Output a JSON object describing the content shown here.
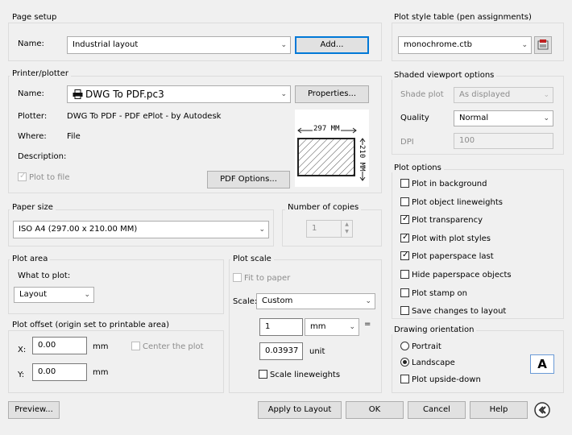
{
  "page_setup": {
    "title": "Page setup",
    "name_label": "Name:",
    "name_value": "Industrial layout",
    "add_button": "Add..."
  },
  "plot_style": {
    "title": "Plot style table (pen assignments)",
    "value": "monochrome.ctb"
  },
  "printer": {
    "title": "Printer/plotter",
    "name_label": "Name:",
    "name_value": "DWG To PDF.pc3",
    "properties_button": "Properties...",
    "plotter_label": "Plotter:",
    "plotter_value": "DWG To PDF - PDF ePlot - by Autodesk",
    "where_label": "Where:",
    "where_value": "File",
    "description_label": "Description:",
    "plot_to_file": "Plot to file",
    "pdf_options_button": "PDF Options...",
    "preview_width": "297 MM",
    "preview_height": "210 MM"
  },
  "shaded": {
    "title": "Shaded viewport options",
    "shade_label": "Shade plot",
    "shade_value": "As displayed",
    "quality_label": "Quality",
    "quality_value": "Normal",
    "dpi_label": "DPI",
    "dpi_value": "100"
  },
  "paper": {
    "title": "Paper size",
    "value": "ISO A4 (297.00 x 210.00 MM)"
  },
  "copies": {
    "title": "Number of copies",
    "value": "1"
  },
  "plot_options": {
    "title": "Plot options",
    "items": [
      {
        "label": "Plot in background",
        "checked": false
      },
      {
        "label": "Plot object lineweights",
        "checked": false
      },
      {
        "label": "Plot transparency",
        "checked": true
      },
      {
        "label": "Plot with plot styles",
        "checked": true
      },
      {
        "label": "Plot paperspace last",
        "checked": true
      },
      {
        "label": "Hide paperspace objects",
        "checked": false
      },
      {
        "label": "Plot stamp on",
        "checked": false
      },
      {
        "label": "Save changes to layout",
        "checked": false
      }
    ]
  },
  "plot_area": {
    "title": "Plot area",
    "what_label": "What to plot:",
    "what_value": "Layout"
  },
  "plot_scale": {
    "title": "Plot scale",
    "fit_label": "Fit to paper",
    "scale_label": "Scale:",
    "scale_value": "Custom",
    "num_value": "1",
    "unit_value": "mm",
    "equals": "=",
    "den_value": "0.03937",
    "den_unit": "unit",
    "lineweights_label": "Scale lineweights"
  },
  "plot_offset": {
    "title": "Plot offset (origin set to printable area)",
    "x_label": "X:",
    "x_value": "0.00",
    "x_unit": "mm",
    "center_label": "Center the plot",
    "y_label": "Y:",
    "y_value": "0.00",
    "y_unit": "mm"
  },
  "orientation": {
    "title": "Drawing orientation",
    "portrait": "Portrait",
    "landscape": "Landscape",
    "upside_down": "Plot upside-down",
    "icon_letter": "A"
  },
  "footer": {
    "preview": "Preview...",
    "apply": "Apply to Layout",
    "ok": "OK",
    "cancel": "Cancel",
    "help": "Help"
  }
}
